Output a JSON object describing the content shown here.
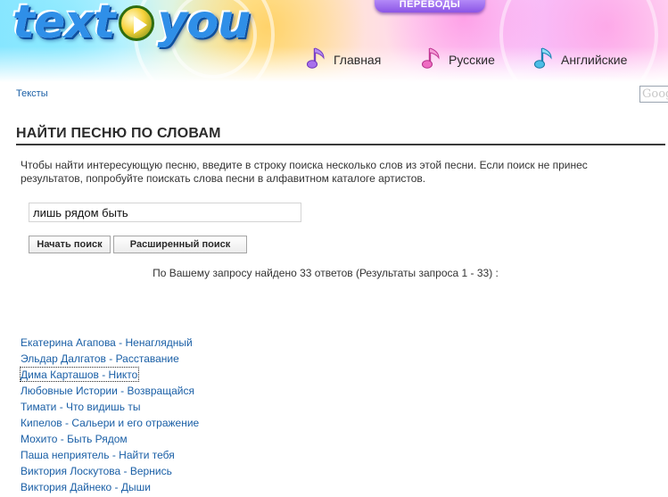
{
  "header": {
    "logo": {
      "word1": "text",
      "word2": "you"
    },
    "translate_button": "ПЕРЕВОДЫ",
    "nav": [
      {
        "label": "Главная",
        "note_color": "#9a5fe0"
      },
      {
        "label": "Русские",
        "note_color": "#e055b8"
      },
      {
        "label": "Английские",
        "note_color": "#2fa6d6"
      }
    ]
  },
  "breadcrumb": "Тексты",
  "google_box": "Goog",
  "page": {
    "title": "НАЙТИ ПЕСНЮ ПО СЛОВАМ",
    "intro": "Чтобы найти интересующую песню, введите в строку поиска несколько слов из этой песни. Если поиск не принес результатов, попробуйте поискать слова песни в алфавитном каталоге артистов."
  },
  "search": {
    "value": "лишь рядом быть",
    "start_label": "Начать поиск",
    "advanced_label": "Расширенный поиск"
  },
  "result_count": "По Вашему запросу найдено 33 ответов (Результаты запроса 1 - 33) :",
  "results": [
    "Екатерина Агапова - Ненаглядный",
    "Эльдар Далгатов - Расставание",
    "Дима Карташов - Никто",
    "Любовные Истории - Возвращайся",
    "Тимати - Что видишь ты",
    "Кипелов - Сальери и его отражение",
    "Мохито - Быть Рядом",
    "Паша неприятель - Найти тебя",
    "Виктория Лоскутова - Вернись",
    "Виктория Дайнеко - Дыши"
  ],
  "focused_result": "Дима Карташов - Никто",
  "colors": {
    "link": "#1a5fa6",
    "title_rule": "#3a3a3a",
    "translate_button": "#8b55e6"
  }
}
